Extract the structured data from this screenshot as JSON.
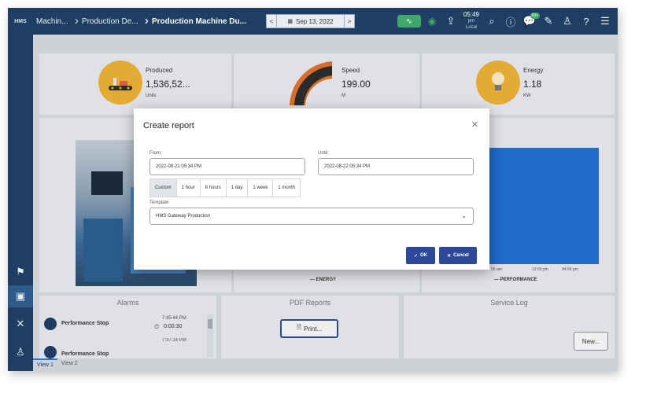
{
  "app": {
    "logo_text": "HMS"
  },
  "breadcrumbs": [
    "Machin...",
    "Production De...",
    "Production Machine Du..."
  ],
  "date_nav": {
    "date": "Sep 13, 2022",
    "prev": "<",
    "next": ">"
  },
  "top": {
    "time": "05:49",
    "time_period": "pm",
    "time_zone": "Local",
    "notif_count": "99+"
  },
  "kpis": [
    {
      "label": "Produced",
      "value": "1,536,52...",
      "unit": "Units"
    },
    {
      "label": "Speed",
      "value": "199.00",
      "unit": "M"
    },
    {
      "label": "Energy",
      "value": "1.18",
      "unit": "KW"
    }
  ],
  "charts": {
    "energy_legend": "— ENERGY",
    "perf_legend": "— PERFORMANCE",
    "perf_ticks": [
      "00 am",
      "12:00 pm",
      "04:00 pm"
    ]
  },
  "alarms": {
    "title": "Alarms",
    "items": [
      {
        "name": "Performance Stop",
        "time": "7:45:44 PM",
        "duration": "0:00:30"
      },
      {
        "name": "Performance Stop",
        "time": "7:37:14 PM",
        "duration": ""
      }
    ]
  },
  "pdf_reports": {
    "title": "PDF Reports",
    "print_label": "Print..."
  },
  "service_log": {
    "title": "Service Log",
    "new_label": "New..."
  },
  "view_tabs": [
    "View 1",
    "View 2"
  ],
  "modal": {
    "title": "Create report",
    "from_label": "From:",
    "from_value": "2022-08-21 05:34 PM",
    "until_label": "Until:",
    "until_value": "2022-08-22 05:34 PM",
    "quick_ranges": [
      "Custom",
      "1 hour",
      "6 hours",
      "1 day",
      "1 week",
      "1 month"
    ],
    "template_label": "Template",
    "template_value": "HMS Gateway Production",
    "ok_label": "OK",
    "cancel_label": "Cancel"
  },
  "colors": {
    "nav": "#1e3e63",
    "accent": "#2c4a99",
    "kpi": "#f2b632",
    "chart_blue": "#1f6fd6"
  }
}
